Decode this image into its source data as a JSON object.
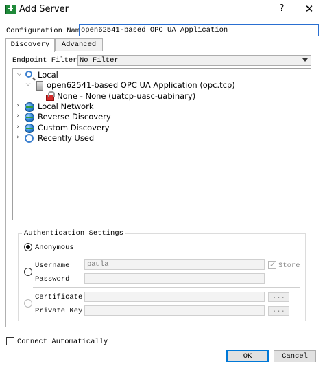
{
  "window": {
    "title": "Add Server",
    "help_label": "?",
    "close_label": "✕"
  },
  "config": {
    "label": "Configuration Name",
    "value": "open62541-based OPC UA Application"
  },
  "tabs": [
    {
      "label": "Discovery",
      "active": true
    },
    {
      "label": "Advanced",
      "active": false
    }
  ],
  "endpoint_filter": {
    "label": "Endpoint Filter:",
    "value": "No Filter"
  },
  "tree": {
    "items": [
      {
        "label": "Local",
        "icon": "magnifier-icon",
        "expanded": true
      },
      {
        "label": "open62541-based OPC UA Application (opc.tcp)",
        "icon": "server-icon",
        "expanded": true
      },
      {
        "label": "None - None (uatcp-uasc-uabinary)",
        "icon": "lock-icon"
      },
      {
        "label": "Local Network",
        "icon": "globe-icon",
        "expanded": false
      },
      {
        "label": "Reverse Discovery",
        "icon": "globe-icon",
        "expanded": false
      },
      {
        "label": "Custom Discovery",
        "icon": "globe-icon",
        "expanded": false
      },
      {
        "label": "Recently Used",
        "icon": "clock-icon",
        "expanded": false
      }
    ]
  },
  "auth": {
    "title": "Authentication Settings",
    "anonymous_label": "Anonymous",
    "username_label": "Username",
    "username_value": "paula",
    "password_label": "Password",
    "password_value": "",
    "store_label": "Store",
    "store_checked": true,
    "certificate_label": "Certificate",
    "private_key_label": "Private Key",
    "browse_label": "...",
    "selected": "anonymous"
  },
  "footer": {
    "connect_auto_label": "Connect Automatically",
    "ok_label": "OK",
    "cancel_label": "Cancel"
  },
  "colors": {
    "accent": "#0078d7",
    "app_icon": "#1f8a3a"
  }
}
